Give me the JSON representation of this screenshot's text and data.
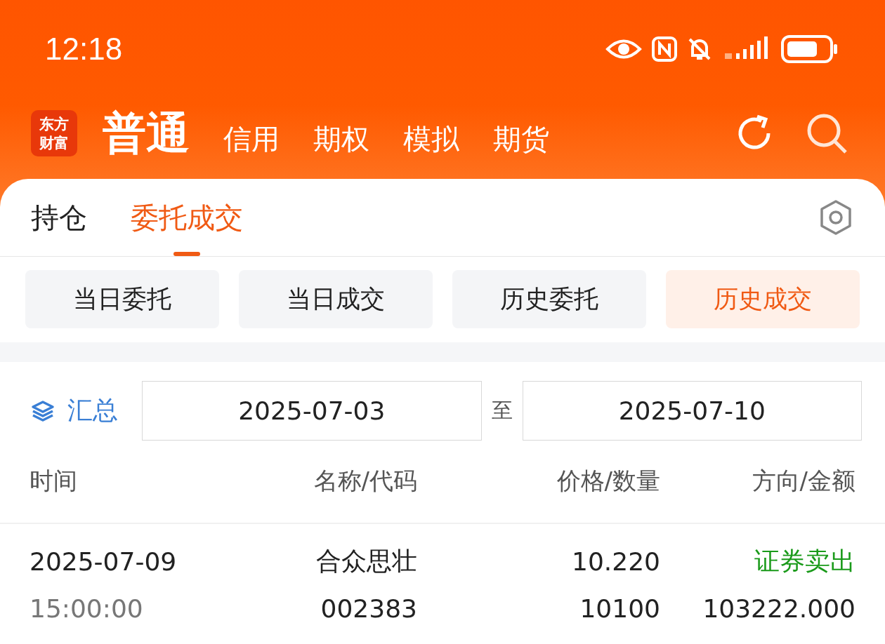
{
  "status_bar": {
    "time": "12:18"
  },
  "header": {
    "logo": "东方财富",
    "tabs": [
      {
        "label": "普通",
        "selected": true
      },
      {
        "label": "信用",
        "selected": false
      },
      {
        "label": "期权",
        "selected": false
      },
      {
        "label": "模拟",
        "selected": false
      },
      {
        "label": "期货",
        "selected": false
      }
    ]
  },
  "tabs": [
    {
      "label": "持仓",
      "selected": false
    },
    {
      "label": "委托成交",
      "selected": true
    }
  ],
  "sub_tabs": [
    {
      "label": "当日委托",
      "selected": false
    },
    {
      "label": "当日成交",
      "selected": false
    },
    {
      "label": "历史委托",
      "selected": false
    },
    {
      "label": "历史成交",
      "selected": true
    }
  ],
  "filter": {
    "summary": "汇总",
    "start_date": "2025-07-03",
    "separator": "至",
    "end_date": "2025-07-10"
  },
  "table": {
    "columns": [
      "时间",
      "名称/代码",
      "价格/数量",
      "方向/金额"
    ],
    "rows": [
      {
        "date": "2025-07-09",
        "time": "15:00:00",
        "name": "合众思壮",
        "code": "002383",
        "price": "10.220",
        "quantity": "10100",
        "direction": "证券卖出",
        "color": "#1a9a1a",
        "amount": "103222.000"
      }
    ]
  }
}
